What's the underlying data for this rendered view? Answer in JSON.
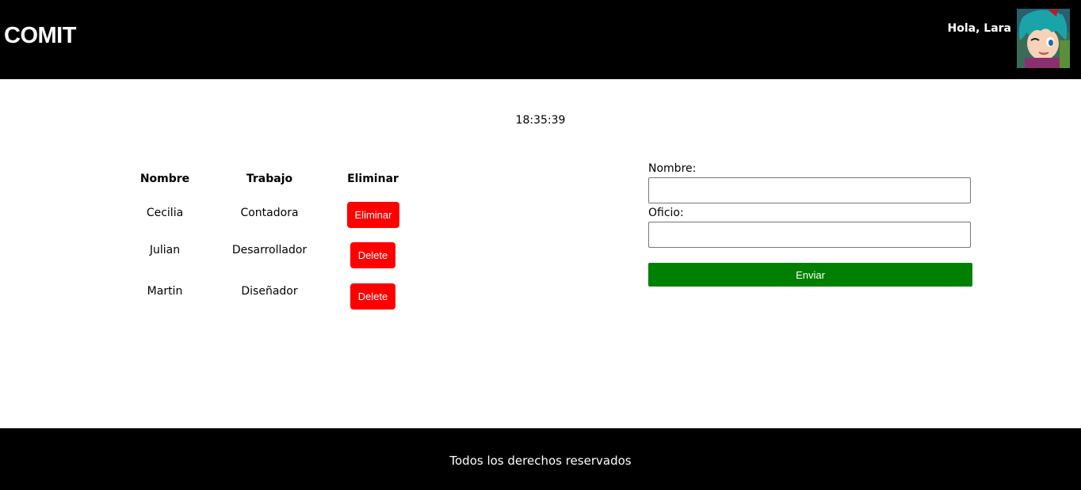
{
  "header": {
    "brand": "COMIT",
    "greeting": "Hola, Lara",
    "avatar_icon": "user-avatar-anime-girl"
  },
  "clock": {
    "time": "18:35:39"
  },
  "table": {
    "headers": {
      "nombre": "Nombre",
      "trabajo": "Trabajo",
      "eliminar": "Eliminar"
    },
    "rows": [
      {
        "nombre": "Cecilia",
        "trabajo": "Contadora",
        "action": "Eliminar"
      },
      {
        "nombre": "Julian",
        "trabajo": "Desarrollador",
        "action": "Delete"
      },
      {
        "nombre": "Martin",
        "trabajo": "Diseñador",
        "action": "Delete"
      }
    ]
  },
  "form": {
    "nombre_label": "Nombre:",
    "nombre_value": "",
    "oficio_label": "Oficio:",
    "oficio_value": "",
    "submit_label": "Enviar"
  },
  "footer": {
    "text": "Todos los derechos reservados"
  },
  "colors": {
    "header_bg": "#000000",
    "delete_button": "#ff0000",
    "submit_button": "#008000"
  }
}
